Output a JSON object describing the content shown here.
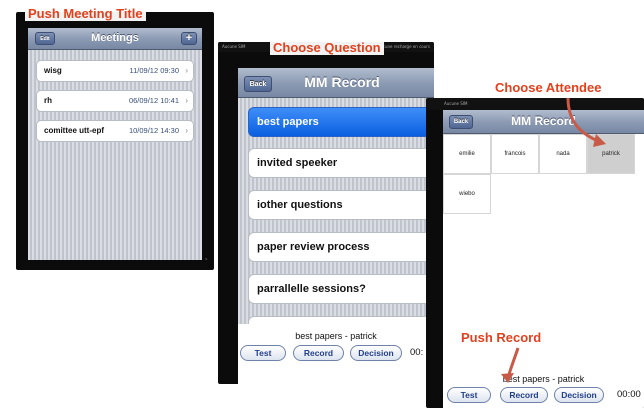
{
  "callouts": {
    "push_meeting_title": "Push Meeting Title",
    "choose_question": "Choose Question",
    "choose_attendee": "Choose Attendee",
    "push_record": "Push Record"
  },
  "screen1": {
    "status_left": "",
    "navbar": {
      "edit_label": "Edit",
      "title": "Meetings",
      "add_icon": "+"
    },
    "meetings": [
      {
        "title": "wisg",
        "datetime": "11/09/12 09:30"
      },
      {
        "title": "rh",
        "datetime": "06/09/12 10:41"
      },
      {
        "title": "comittee utt-epf",
        "datetime": "10/09/12 14:30"
      }
    ]
  },
  "screen2": {
    "status_left": "Aucune SIM",
    "status_right": "Aucune recharge en cours",
    "navbar": {
      "back_label": "Back",
      "title": "MM Record"
    },
    "questions": [
      {
        "label": "best papers",
        "selected": true
      },
      {
        "label": "invited speeker",
        "selected": false
      },
      {
        "label": "iother questions",
        "selected": false
      },
      {
        "label": "paper review process",
        "selected": false
      },
      {
        "label": "parrallelle sessions?",
        "selected": false
      }
    ],
    "current": "best papers - patrick",
    "buttons": {
      "test": "Test",
      "record": "Record",
      "decision": "Decision"
    },
    "timer": "00:"
  },
  "screen3": {
    "status_left": "Aucune SIM",
    "navbar": {
      "back_label": "Back",
      "title": "MM Record"
    },
    "attendees": [
      {
        "name": "emilie",
        "selected": false
      },
      {
        "name": "francois",
        "selected": false
      },
      {
        "name": "nada",
        "selected": false
      },
      {
        "name": "patrick",
        "selected": true
      },
      {
        "name": "wiebo",
        "selected": false
      }
    ],
    "current": "best papers - patrick",
    "buttons": {
      "test": "Test",
      "record": "Record",
      "decision": "Decision"
    },
    "timer": "00:00"
  },
  "colors": {
    "callout": "#e2411d",
    "selection_blue": "#0a5fe0",
    "navbar": "#8d9cb4"
  }
}
